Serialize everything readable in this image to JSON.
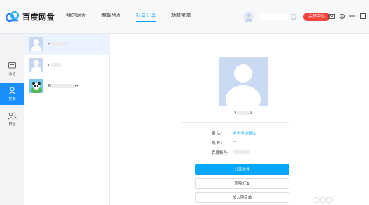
{
  "app": {
    "title": "百度网盘"
  },
  "nav": [
    {
      "label": "我的网盘",
      "active": false
    },
    {
      "label": "传输列表",
      "active": false
    },
    {
      "label": "好友分享",
      "active": true
    },
    {
      "label": "功能宝箱",
      "active": false
    }
  ],
  "header": {
    "vip_label": "会员中心"
  },
  "sidebar": [
    {
      "label": "会话",
      "icon": "chat-icon",
      "active": false
    },
    {
      "label": "好友",
      "icon": "friend-icon",
      "active": true
    },
    {
      "label": "群组",
      "icon": "group-icon",
      "active": false
    }
  ],
  "friends": [
    {
      "name_prefix": "s",
      "name_suffix": "1",
      "avatar": "default-avatar",
      "selected": true
    },
    {
      "name_prefix": "c",
      "name_suffix": "",
      "avatar": "default-avatar",
      "selected": false
    },
    {
      "name_prefix": "B",
      "name_suffix": "e",
      "avatar": "panda-avatar",
      "selected": false
    }
  ],
  "detail": {
    "name_prefix": "s",
    "name_suffix": "1",
    "remark_label": "备    注:",
    "remark_value": "点击添加备注",
    "nickname_label": "昵    称:",
    "nickname_value": "--",
    "account_label": "百度帐号:",
    "account_value": "",
    "share_button": "分享文件",
    "delete_button": "删除好友",
    "blacklist_button": "加入黑名单"
  },
  "colors": {
    "accent": "#06a7ff",
    "vip": "#f0443c",
    "sidebar_active": "#1a8eff"
  }
}
